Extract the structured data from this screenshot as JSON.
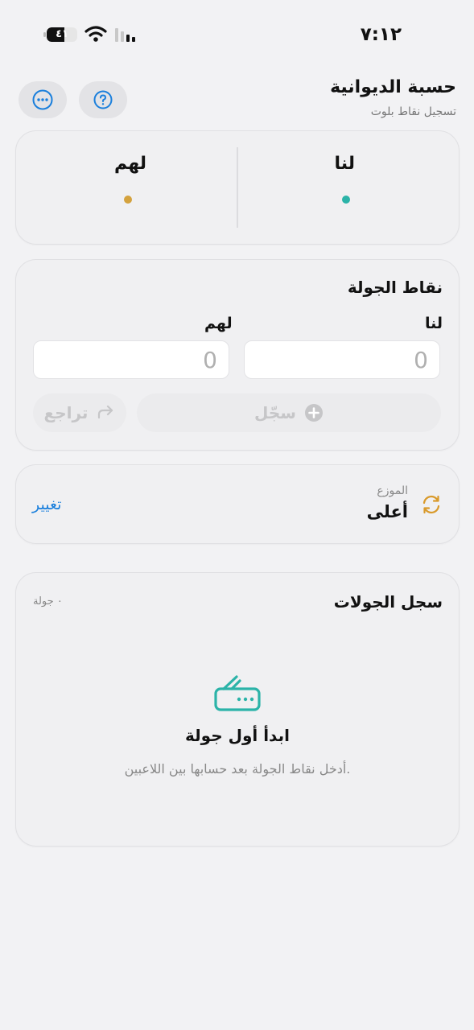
{
  "status_bar": {
    "time": "٧:١٢",
    "battery": "٤١"
  },
  "header": {
    "title": "حسبة الديوانية",
    "subtitle": "تسجيل نقاط بلوت"
  },
  "scoreboard": {
    "us_label": "لنا",
    "them_label": "لهم",
    "us_color": "#2bb3a8",
    "them_color": "#d4a23e"
  },
  "round_points": {
    "title": "نقاط الجولة",
    "us_label": "لنا",
    "them_label": "لهم",
    "us_placeholder": "0",
    "them_placeholder": "0",
    "record_label": "سجّل",
    "undo_label": "تراجع"
  },
  "dealer": {
    "caption": "الموزع",
    "value": "أعلى",
    "change_label": "تغيير",
    "accent": "#d99a2b"
  },
  "history": {
    "title": "سجل الجولات",
    "count": "٠ جولة",
    "empty_title": "ابدأ أول جولة",
    "empty_desc": "أدخل نقاط الجولة بعد حسابها بين اللاعبين.",
    "icon_color": "#2bb3a8"
  },
  "icons": [
    "battery-icon",
    "wifi-icon",
    "signal-icon",
    "help-icon",
    "more-icon",
    "plus-circle-icon",
    "undo-icon",
    "rotate-icon",
    "cards-icon"
  ]
}
